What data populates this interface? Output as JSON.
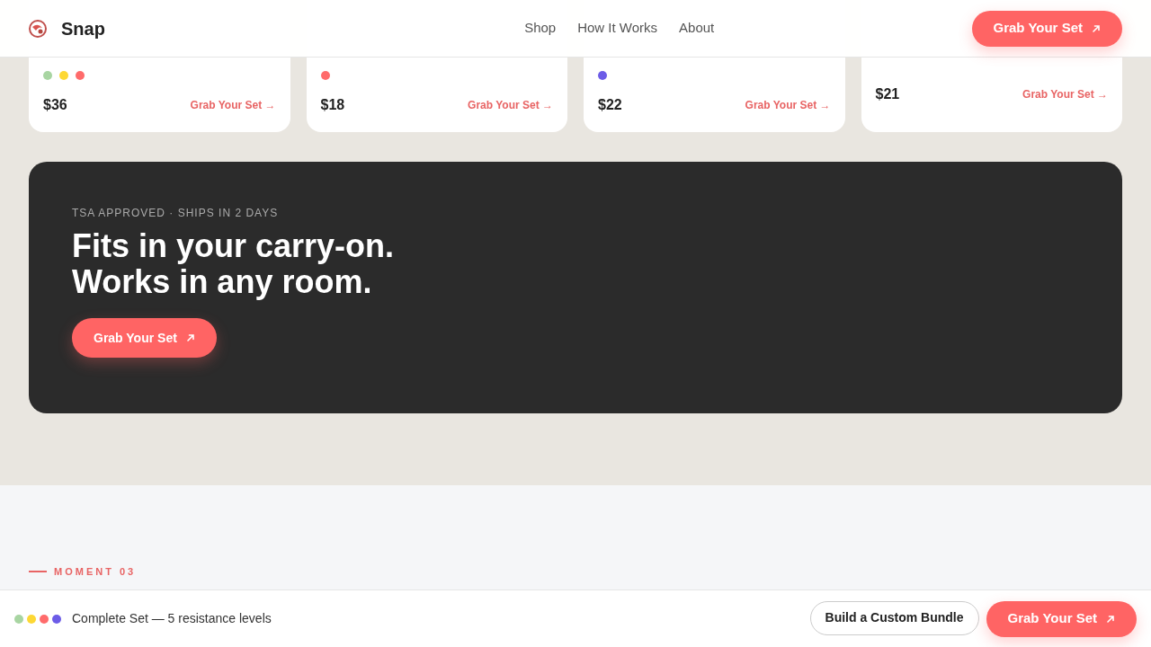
{
  "navbar": {
    "brand": "Snap",
    "links": [
      "Shop",
      "How It Works",
      "About"
    ],
    "cta": "Grab Your Set"
  },
  "products": [
    {
      "dots": [
        {
          "color": "#a8d5a2"
        },
        {
          "color": "#fdd835"
        },
        {
          "color": "#ff6b6b"
        }
      ],
      "price": "$36",
      "link": "Grab Your Set →"
    },
    {
      "dots": [
        {
          "color": "#ff6b6b"
        }
      ],
      "price": "$18",
      "link": "Grab Your Set →"
    },
    {
      "dots": [
        {
          "color": "#6c5ce7"
        }
      ],
      "price": "$22",
      "link": "Grab Your Set →"
    },
    {
      "price": "$21",
      "link": "Grab Your Set →"
    }
  ],
  "banner": {
    "eyebrow": "TSA APPROVED · SHIPS IN 2 DAYS",
    "headline_lines": [
      "Fits in your carry-on.",
      "Works in any room."
    ],
    "cta": "Grab Your Set"
  },
  "section": {
    "label": "MOMENT 03"
  },
  "bottom_bar": {
    "dots": [
      {
        "color": "#a8d5a2"
      },
      {
        "color": "#fdd835"
      },
      {
        "color": "#ff6b6b"
      },
      {
        "color": "#6c5ce7"
      }
    ],
    "text": "Complete Set — 5 resistance levels",
    "secondary": "Build a Custom Bundle",
    "cta": "Grab Your Set"
  }
}
